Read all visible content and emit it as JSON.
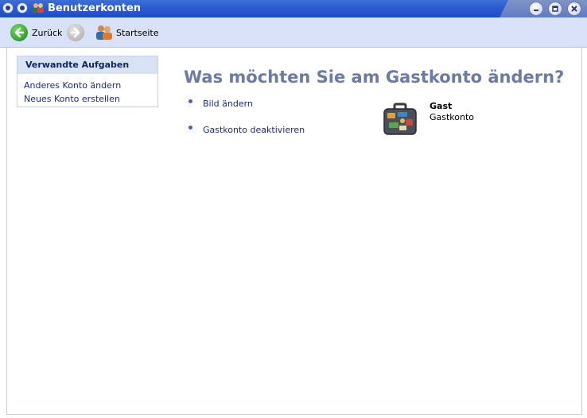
{
  "window": {
    "title": "Benutzerkonten"
  },
  "toolbar": {
    "back_label": "Zurück",
    "home_label": "Startseite"
  },
  "sidepanel": {
    "title": "Verwandte Aufgaben",
    "links": [
      "Anderes Konto ändern",
      "Neues Konto erstellen"
    ]
  },
  "main": {
    "heading": "Was möchten Sie am Gastkonto ändern?",
    "tasks": [
      "Bild ändern",
      "Gastkonto deaktivieren"
    ],
    "account": {
      "name": "Gast",
      "type": "Gastkonto"
    }
  },
  "colors": {
    "titlebar": "#2b5bd0",
    "toolbar": "#d8e1f5",
    "heading": "#6b7aa6",
    "link": "#1a2a8a"
  }
}
